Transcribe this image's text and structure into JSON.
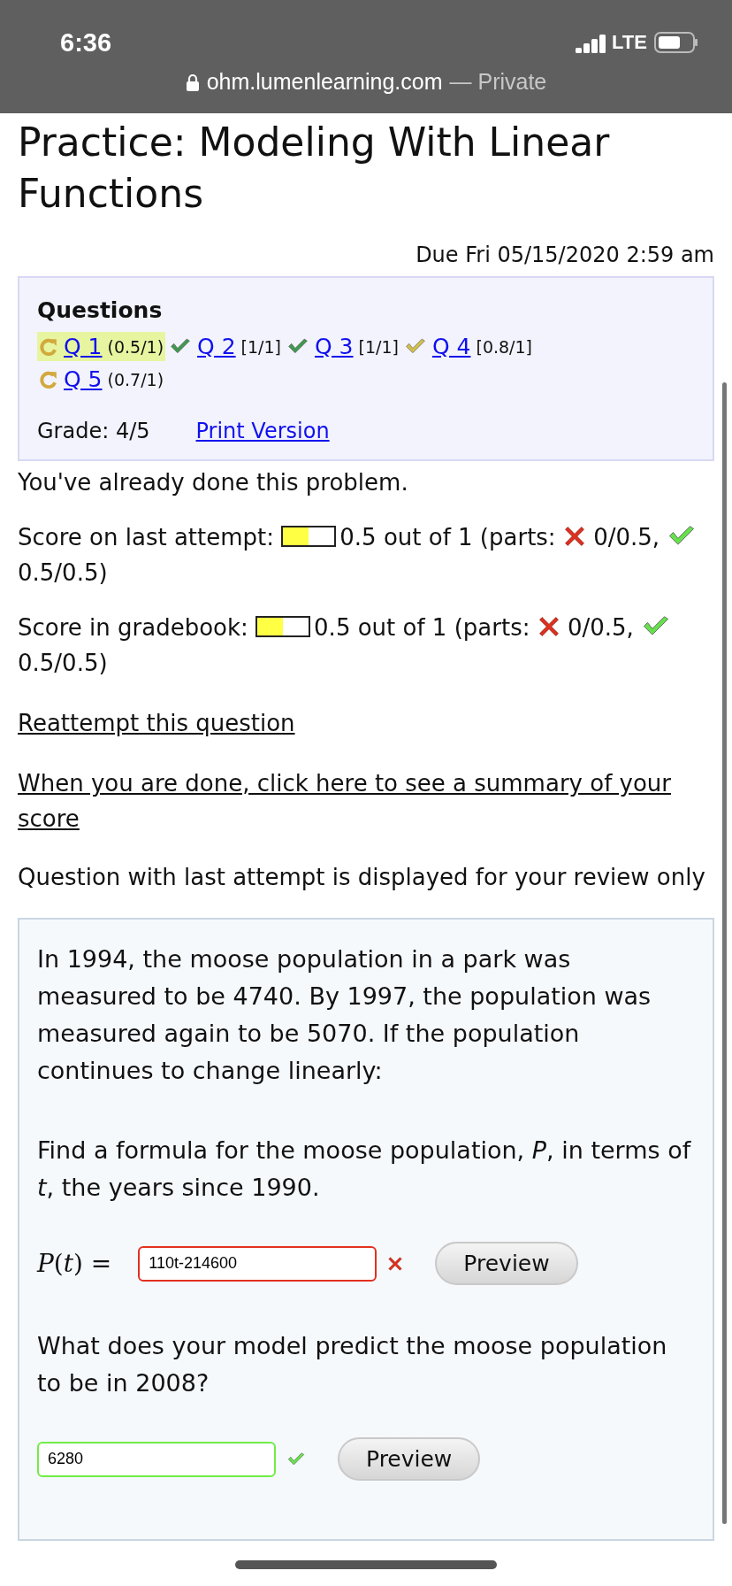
{
  "status_bar": {
    "time": "6:36",
    "network": "LTE",
    "url": "ohm.lumenlearning.com",
    "mode": "— Private"
  },
  "title": "Practice: Modeling With Linear Functions",
  "due": "Due Fri 05/15/2020 2:59 am",
  "questions": {
    "heading": "Questions",
    "items": [
      {
        "label": "Q 1",
        "score": "(0.5/1)",
        "kind": "retry",
        "selected": true
      },
      {
        "label": "Q 2",
        "score": "[1/1]",
        "kind": "correct",
        "selected": false
      },
      {
        "label": "Q 3",
        "score": "[1/1]",
        "kind": "correct",
        "selected": false
      },
      {
        "label": "Q 4",
        "score": "[0.8/1]",
        "kind": "partial",
        "selected": false
      },
      {
        "label": "Q 5",
        "score": "(0.7/1)",
        "kind": "retry",
        "selected": false
      }
    ],
    "grade": "Grade: 4/5",
    "print_link": "Print Version"
  },
  "notice": "You've already done this problem.",
  "scores": [
    {
      "label": "Score on last attempt:",
      "level": 0.5,
      "summary": "0.5 out of 1 (parts:",
      "parts": [
        {
          "kind": "wrong",
          "text": "0/0.5,"
        },
        {
          "kind": "correct",
          "text": "0.5/0.5)"
        }
      ]
    },
    {
      "label": "Score in gradebook:",
      "level": 0.5,
      "summary": "0.5 out of 1 (parts:",
      "parts": [
        {
          "kind": "wrong",
          "text": "0/0.5,"
        },
        {
          "kind": "correct",
          "text": "0.5/0.5)"
        }
      ]
    }
  ],
  "links": [
    "Reattempt this question",
    "When you are done, click here to see a summary of your score"
  ],
  "review_note": "Question with last attempt is displayed for your review only",
  "question": {
    "intro": "In 1994, the moose population in a park was measured to be 4740. By 1997, the population was measured again to be 5070. If the population continues to change linearly:",
    "parts": [
      {
        "prompt": "Find a formula for the moose population, *P*, in terms of *t*, the years since 1990.",
        "label": "*P*(*t*) =",
        "value": "110t-214600",
        "kind": "wrong",
        "button": "Preview"
      },
      {
        "prompt": "What does your model predict the moose population to be in 2008?",
        "value": "6280",
        "kind": "correct",
        "button": "Preview"
      }
    ]
  }
}
